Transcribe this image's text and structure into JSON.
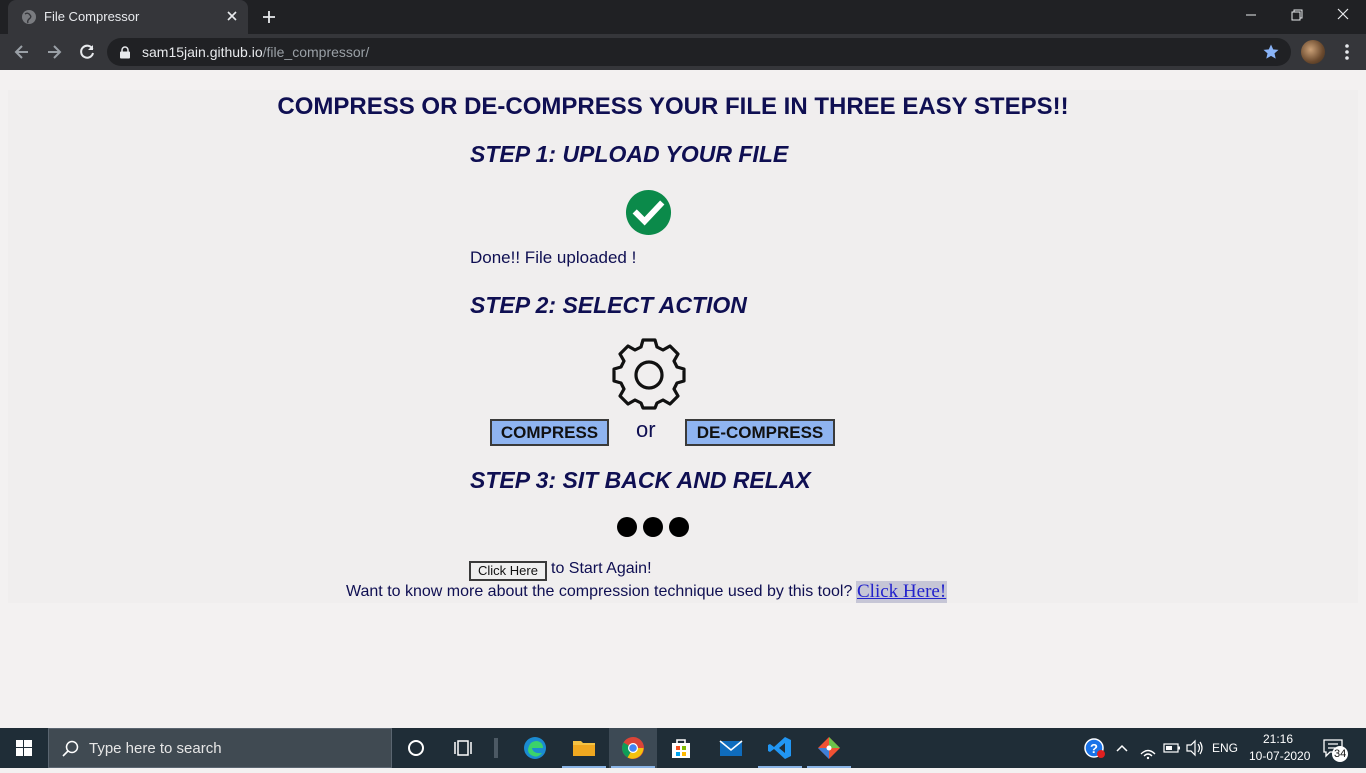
{
  "browser": {
    "tab_title": "File Compressor",
    "url_domain": "sam15jain.github.io",
    "url_path": "/file_compressor/"
  },
  "page": {
    "main_heading": "COMPRESS OR DE-COMPRESS YOUR FILE IN THREE EASY STEPS!!",
    "step1_heading": "STEP 1: UPLOAD YOUR FILE",
    "upload_status": "Done!! File uploaded !",
    "step2_heading": "STEP 2: SELECT  ACTION",
    "compress_label": "COMPRESS",
    "or_label": "or",
    "decompress_label": "DE-COMPRESS",
    "step3_heading": "STEP 3: SIT BACK AND RELAX",
    "again_button_label": "Click Here",
    "again_text": "to Start Again!",
    "info_text": "Want to know more about the compression technique used by this tool?",
    "info_link_label": "Click Here!",
    "colors": {
      "heading": "#0f0f52",
      "action_button": "#8fb4f0",
      "check_green": "#0b8a4a"
    }
  },
  "taskbar": {
    "search_placeholder": "Type here to search",
    "apps": [
      "task-view",
      "edge",
      "file-explorer",
      "chrome",
      "store",
      "mail",
      "vscode",
      "git"
    ],
    "language": "ENG",
    "time": "21:16",
    "date": "10-07-2020",
    "notification_count": "34"
  }
}
